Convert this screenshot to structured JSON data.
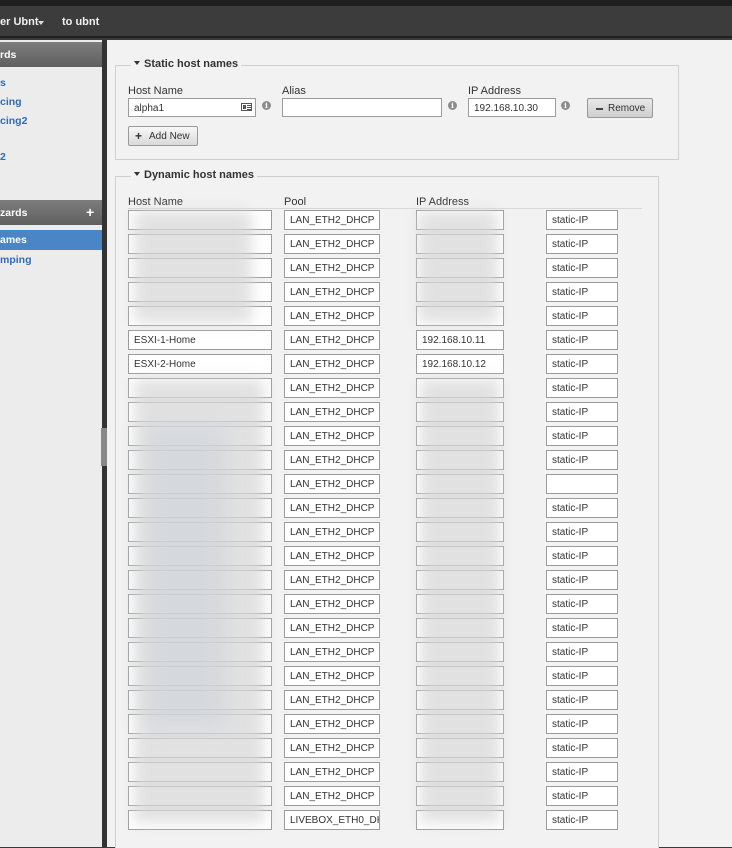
{
  "topbar": {
    "menu1": "er Ubnt",
    "menu2": "to ubnt"
  },
  "sidebar": {
    "header1": "rds",
    "links": [
      "s",
      "cing",
      "cing2",
      "2"
    ],
    "header2": "zards",
    "active_item": "ames",
    "link_after_active": "mping"
  },
  "static": {
    "legend": "Static host names",
    "host_label": "Host Name",
    "alias_label": "Alias",
    "ip_label": "IP Address",
    "host_value": "alpha1",
    "alias_value": "",
    "ip_value": "192.168.10.30",
    "remove_label": "Remove",
    "add_label": "Add New"
  },
  "dynamic": {
    "legend": "Dynamic host names",
    "col_host": "Host Name",
    "col_pool": "Pool",
    "col_ip": "IP Address",
    "rows": [
      {
        "host": "",
        "pool": "LAN_ETH2_DHCP",
        "ip": "",
        "static": "static-IP"
      },
      {
        "host": "",
        "pool": "LAN_ETH2_DHCP",
        "ip": "",
        "static": "static-IP"
      },
      {
        "host": "",
        "pool": "LAN_ETH2_DHCP",
        "ip": "",
        "static": "static-IP"
      },
      {
        "host": "",
        "pool": "LAN_ETH2_DHCP",
        "ip": "",
        "static": "static-IP"
      },
      {
        "host": "",
        "pool": "LAN_ETH2_DHCP",
        "ip": "",
        "static": "static-IP"
      },
      {
        "host": "ESXI-1-Home",
        "pool": "LAN_ETH2_DHCP",
        "ip": "192.168.10.11",
        "static": "static-IP"
      },
      {
        "host": "ESXI-2-Home",
        "pool": "LAN_ETH2_DHCP",
        "ip": "192.168.10.12",
        "static": "static-IP"
      },
      {
        "host": "",
        "pool": "LAN_ETH2_DHCP",
        "ip": "",
        "static": "static-IP"
      },
      {
        "host": "",
        "pool": "LAN_ETH2_DHCP",
        "ip": "",
        "static": "static-IP"
      },
      {
        "host": "",
        "pool": "LAN_ETH2_DHCP",
        "ip": "",
        "static": "static-IP"
      },
      {
        "host": "",
        "pool": "LAN_ETH2_DHCP",
        "ip": "",
        "static": "static-IP"
      },
      {
        "host": "",
        "pool": "LAN_ETH2_DHCP",
        "ip": "",
        "static": ""
      },
      {
        "host": "",
        "pool": "LAN_ETH2_DHCP",
        "ip": "",
        "static": "static-IP"
      },
      {
        "host": "",
        "pool": "LAN_ETH2_DHCP",
        "ip": "",
        "static": "static-IP"
      },
      {
        "host": "",
        "pool": "LAN_ETH2_DHCP",
        "ip": "",
        "static": "static-IP"
      },
      {
        "host": "",
        "pool": "LAN_ETH2_DHCP",
        "ip": "",
        "static": "static-IP"
      },
      {
        "host": "",
        "pool": "LAN_ETH2_DHCP",
        "ip": "",
        "static": "static-IP"
      },
      {
        "host": "",
        "pool": "LAN_ETH2_DHCP",
        "ip": "",
        "static": "static-IP"
      },
      {
        "host": "",
        "pool": "LAN_ETH2_DHCP",
        "ip": "",
        "static": "static-IP"
      },
      {
        "host": "",
        "pool": "LAN_ETH2_DHCP",
        "ip": "",
        "static": "static-IP"
      },
      {
        "host": "",
        "pool": "LAN_ETH2_DHCP",
        "ip": "",
        "static": "static-IP"
      },
      {
        "host": "",
        "pool": "LAN_ETH2_DHCP",
        "ip": "",
        "static": "static-IP"
      },
      {
        "host": "",
        "pool": "LAN_ETH2_DHCP",
        "ip": "",
        "static": "static-IP"
      },
      {
        "host": "",
        "pool": "LAN_ETH2_DHCP",
        "ip": "",
        "static": "static-IP"
      },
      {
        "host": "",
        "pool": "LAN_ETH2_DHCP",
        "ip": "",
        "static": "static-IP"
      },
      {
        "host": "",
        "pool": "LIVEBOX_ETH0_DH",
        "ip": "",
        "static": "static-IP"
      }
    ]
  }
}
